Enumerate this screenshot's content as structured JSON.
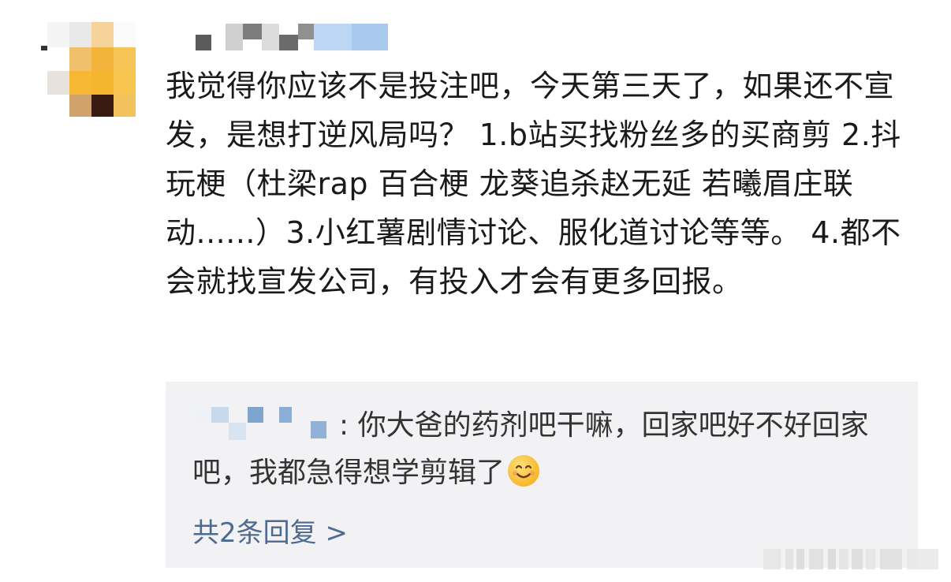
{
  "comment": {
    "body": "我觉得你应该不是投注吧，今天第三天了，如果还不宣发，是想打逆风局吗？ 1.b站买找粉丝多的买商剪 2.抖玩梗（杜梁rap 百合梗 龙葵追杀赵无延 若曦眉庄联动......）3.小红薯剧情讨论、服化道讨论等等。 4.都不会就找宣发公司，有投入才会有更多回报。"
  },
  "reply": {
    "text": ": 你大爸的药剂吧干嘛，回家吧好不好回家吧，我都急得想学剪辑了",
    "emoji": "smile-emoji"
  },
  "more_replies": "共2条回复 >",
  "colors": {
    "text": "#1a1a1a",
    "reply_bg": "#f2f2f4",
    "link": "#4e6a91"
  }
}
